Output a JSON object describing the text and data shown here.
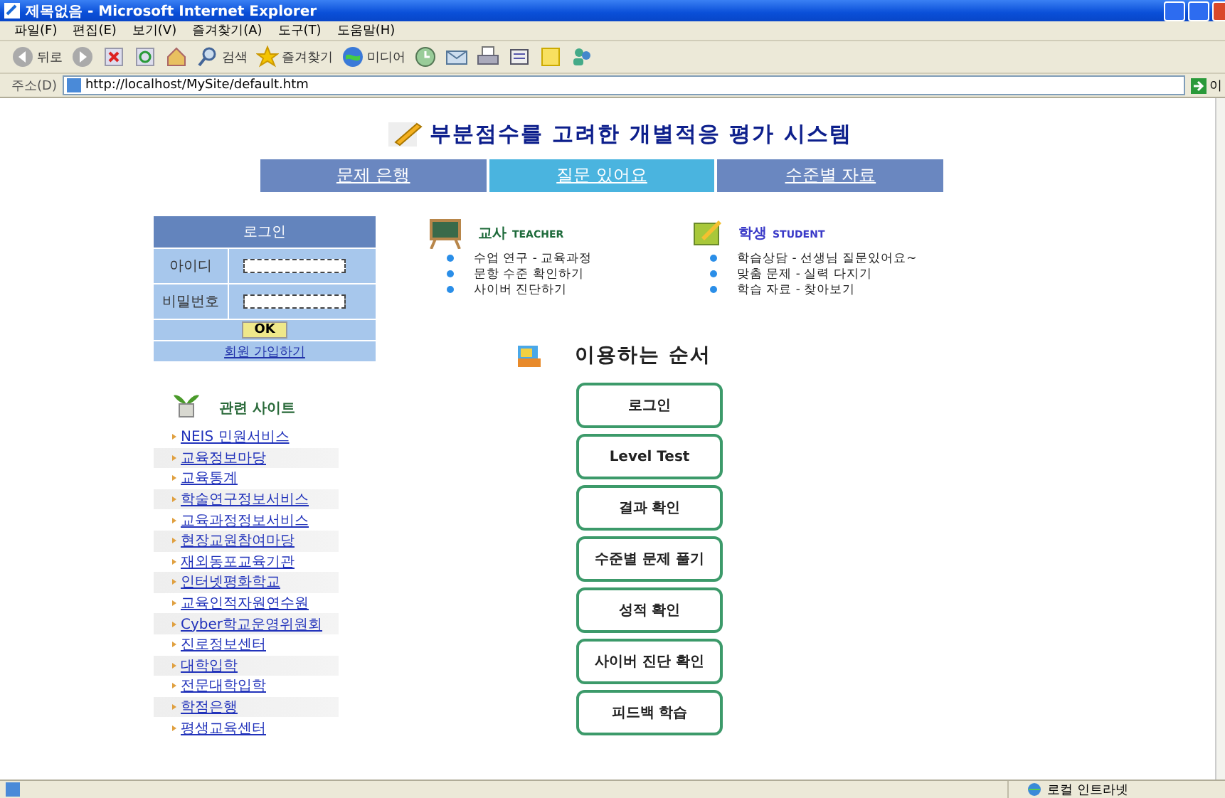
{
  "window": {
    "title": "제목없음 - Microsoft Internet Explorer"
  },
  "menu": [
    "파일(F)",
    "편집(E)",
    "보기(V)",
    "즐겨찾기(A)",
    "도구(T)",
    "도움말(H)"
  ],
  "toolbar": [
    {
      "kind": "back",
      "label": "뒤로"
    },
    {
      "kind": "forward"
    },
    {
      "kind": "stop"
    },
    {
      "kind": "refresh"
    },
    {
      "kind": "home"
    },
    {
      "kind": "search",
      "label": "검색"
    },
    {
      "kind": "favorites",
      "label": "즐겨찾기"
    },
    {
      "kind": "media",
      "label": "미디어"
    },
    {
      "kind": "history"
    },
    {
      "kind": "mail"
    },
    {
      "kind": "print"
    },
    {
      "kind": "edit"
    },
    {
      "kind": "note"
    },
    {
      "kind": "people"
    }
  ],
  "address": {
    "label": "주소(D)",
    "url": "http://localhost/MySite/default.htm",
    "go": "이"
  },
  "page": {
    "title": "부분점수를 고려한 개별적응 평가 시스템",
    "nav": [
      {
        "label": "문제 은행",
        "selected": false
      },
      {
        "label": "질문 있어요",
        "selected": true
      },
      {
        "label": "수준별 자료",
        "selected": false
      }
    ],
    "login": {
      "title": "로그인",
      "id_label": "아이디",
      "password_label": "비밀번호",
      "ok": "OK",
      "join": "회원 가입하기"
    },
    "related": {
      "title": "관련 사이트",
      "links": [
        "NEIS 민원서비스",
        "교육정보마당",
        "교육통계",
        "학술연구정보서비스",
        "교육과정정보서비스",
        "현장교원참여마당",
        "재외동포교육기관",
        "인터넷평화학교",
        "교육인적자원연수원",
        "Cyber학교운영위원회",
        "진로정보센터",
        "대학입학",
        "전문대학입학",
        "학점은행",
        "평생교육센터"
      ]
    },
    "groups": [
      {
        "kind": "teacher",
        "title": "교사",
        "subtitle": "TEACHER",
        "items": [
          "수업 연구 - 교육과정",
          "문항 수준 확인하기",
          "사이버 진단하기"
        ]
      },
      {
        "kind": "student",
        "title": "학생",
        "subtitle": "STUDENT",
        "items": [
          "학습상담 - 선생님 질문있어요~",
          "맞춤 문제 - 실력 다지기",
          "학습 자료 - 찾아보기"
        ]
      }
    ],
    "steps_title": "이용하는 순서",
    "steps": [
      "로그인",
      "Level Test",
      "결과 확인",
      "수준별 문제 풀기",
      "성적 확인",
      "사이버 진단 확인",
      "피드백 학습"
    ]
  },
  "status_bar": {
    "zone": "로컬 인트라넷"
  }
}
